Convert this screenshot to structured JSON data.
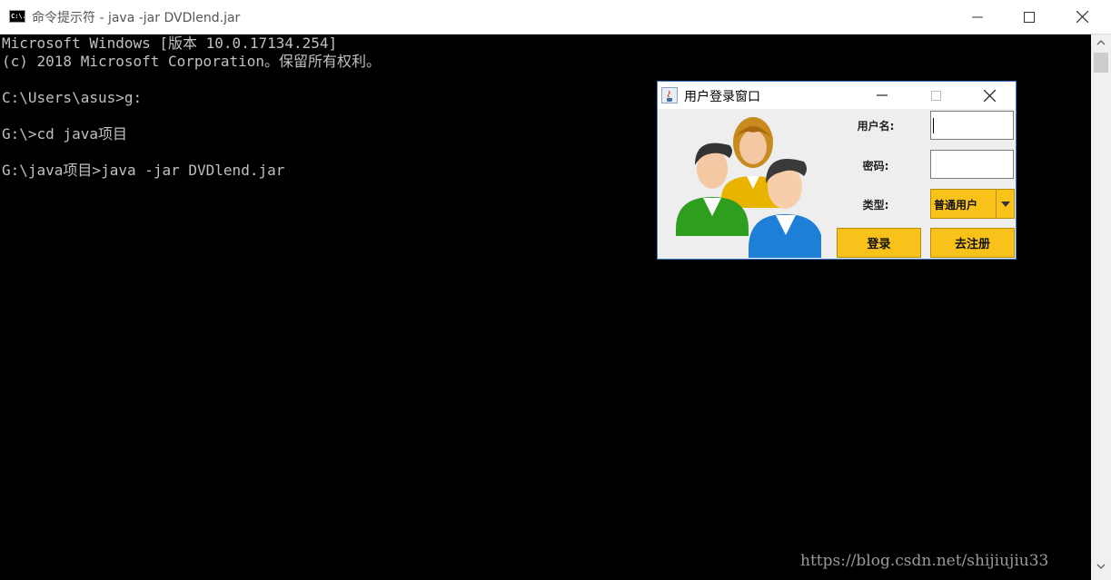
{
  "window": {
    "icon": "cmd-icon",
    "icon_text": "C:\\.",
    "title": "命令提示符 - java  -jar DVDlend.jar",
    "minimize_icon": "minimize-icon",
    "maximize_icon": "maximize-icon",
    "close_icon": "close-icon"
  },
  "console": {
    "lines": [
      "Microsoft Windows [版本 10.0.17134.254]",
      "(c) 2018 Microsoft Corporation。保留所有权利。",
      "",
      "C:\\Users\\asus>g:",
      "",
      "G:\\>cd java项目",
      "",
      "G:\\java项目>java -jar DVDlend.jar"
    ],
    "text_color": "#c0c0c0",
    "background": "#000000"
  },
  "watermark": "https://blog.csdn.net/shijiujiu33",
  "dialog": {
    "icon": "java-icon",
    "title": "用户登录窗口",
    "minimize_icon": "minimize-icon",
    "maximize_icon": "maximize-icon",
    "close_icon": "close-icon",
    "image": "users-group-icon",
    "username_label": "用户名:",
    "username_value": "",
    "password_label": "密码:",
    "password_value": "",
    "type_label": "类型:",
    "type_selected": "普通用户",
    "login_button": "登录",
    "register_button": "去注册",
    "accent_color": "#f9c21a"
  }
}
